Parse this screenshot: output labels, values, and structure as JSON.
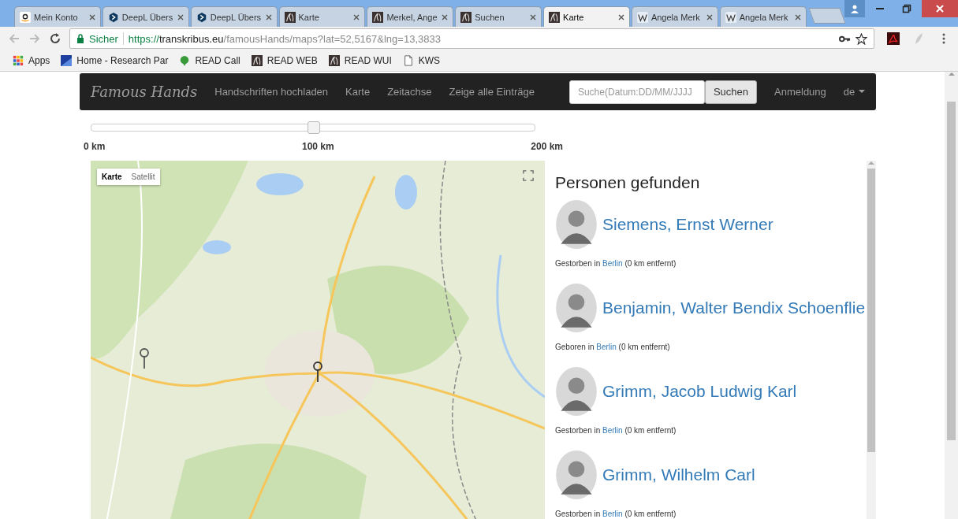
{
  "tabs": [
    {
      "label": "Mein Konto",
      "kind": "amazon",
      "selected": false
    },
    {
      "label": "DeepL Übers",
      "kind": "deepl",
      "selected": false
    },
    {
      "label": "DeepL Übers",
      "kind": "deepl",
      "selected": false
    },
    {
      "label": "Karte",
      "kind": "read",
      "selected": false
    },
    {
      "label": "Merkel, Ange",
      "kind": "read",
      "selected": false
    },
    {
      "label": "Suchen",
      "kind": "read",
      "selected": false
    },
    {
      "label": "Karte",
      "kind": "read",
      "selected": true
    },
    {
      "label": "Angela Merk",
      "kind": "wiki",
      "selected": false
    },
    {
      "label": "Angela Merk",
      "kind": "wiki",
      "selected": false
    }
  ],
  "address": {
    "security": "Sicher",
    "scheme": "https://",
    "host": "transkribus.eu",
    "path": "/famousHands/maps?lat=52,5167&lng=13,3833"
  },
  "bookmarks": [
    {
      "label": "Apps",
      "kind": "apps"
    },
    {
      "label": "Home - Research Par",
      "kind": "research"
    },
    {
      "label": "READ Call",
      "kind": "call"
    },
    {
      "label": "READ WEB",
      "kind": "read"
    },
    {
      "label": "READ WUI",
      "kind": "read"
    },
    {
      "label": "KWS",
      "kind": "page"
    }
  ],
  "navbar": {
    "brand": "Famous Hands",
    "links": [
      "Handschriften hochladen",
      "Karte",
      "Zeitachse",
      "Zeige alle Einträge"
    ],
    "search": {
      "placeholder": "Suche(Datum:DD/MM/JJJJ"
    },
    "search_button": "Suchen",
    "login": "Anmeldung",
    "language": "de"
  },
  "radius": {
    "level": 0.5,
    "labels": [
      "0 km",
      "100 km",
      "200 km"
    ]
  },
  "map": {
    "kind": "picture",
    "types": [
      {
        "label": "Karte",
        "selected": true
      },
      {
        "label": "Satellit",
        "selected": false
      }
    ]
  },
  "results": {
    "title": "Personen gefunden",
    "persons": [
      {
        "name": "Siemens, Ernst Werner",
        "event": "Gestorben in",
        "place": "Berlin",
        "distance": "(0 km entfernt)"
      },
      {
        "name": "Benjamin, Walter Bendix Schoenflie",
        "event": "Geboren in",
        "place": "Berlin",
        "distance": "(0 km entfernt)"
      },
      {
        "name": "Grimm, Jacob Ludwig Karl",
        "event": "Gestorben in",
        "place": "Berlin",
        "distance": "(0 km entfernt)"
      },
      {
        "name": "Grimm, Wilhelm Carl",
        "event": "Gestorben in",
        "place": "Berlin",
        "distance": "(0 km entfernt)"
      }
    ]
  }
}
